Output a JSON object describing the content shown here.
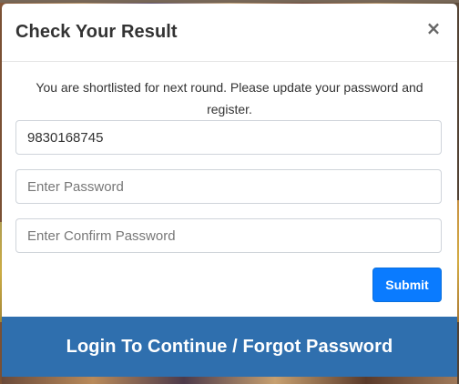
{
  "modal": {
    "title": "Check Your Result",
    "close_symbol": "×",
    "message": "You are shortlisted for next round. Please update your password and register."
  },
  "form": {
    "mobile": {
      "value": "9830168745",
      "placeholder": ""
    },
    "password": {
      "value": "",
      "placeholder": "Enter Password"
    },
    "confirm_password": {
      "value": "",
      "placeholder": "Enter Confirm Password"
    },
    "submit_label": "Submit"
  },
  "footer": {
    "label": "Login To Continue / Forgot Password"
  },
  "colors": {
    "primary_button": "#0a7bff",
    "footer_bar": "#2f6fae"
  },
  "icons": {
    "close": "close-icon"
  }
}
